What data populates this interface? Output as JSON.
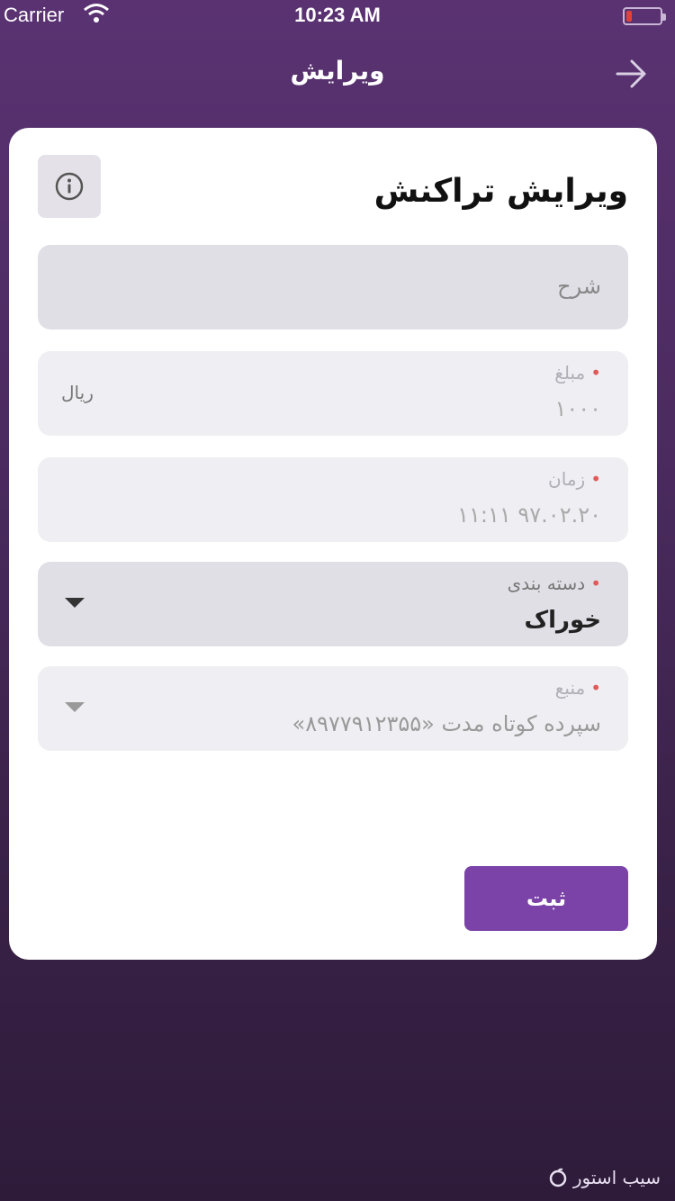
{
  "status_bar": {
    "carrier": "Carrier",
    "time": "10:23 AM",
    "battery_color": "#e0413a"
  },
  "nav": {
    "title": "ویرایش",
    "back_icon": "arrow-right-icon"
  },
  "card": {
    "title": "ویرایش تراکنش",
    "info_icon": "info-icon"
  },
  "fields": {
    "description": {
      "placeholder": "شرح"
    },
    "amount": {
      "label": "مبلغ",
      "value": "۱۰۰۰",
      "unit": "ریال"
    },
    "time": {
      "label": "زمان",
      "value": "۹۷.۰۲.۲۰ ۱۱:۱۱"
    },
    "category": {
      "label": "دسته بندی",
      "value": "خوراک"
    },
    "source": {
      "label": "منبع",
      "value": "سپرده کوتاه مدت «۸۹۷۷۹۱۲۳۵۵»"
    }
  },
  "submit_label": "ثبت",
  "watermark": "سیب استور",
  "colors": {
    "accent": "#7b43a8",
    "background_top": "#5a3272",
    "background_bottom": "#2e1b3a",
    "required_dot": "#e05a5a"
  }
}
